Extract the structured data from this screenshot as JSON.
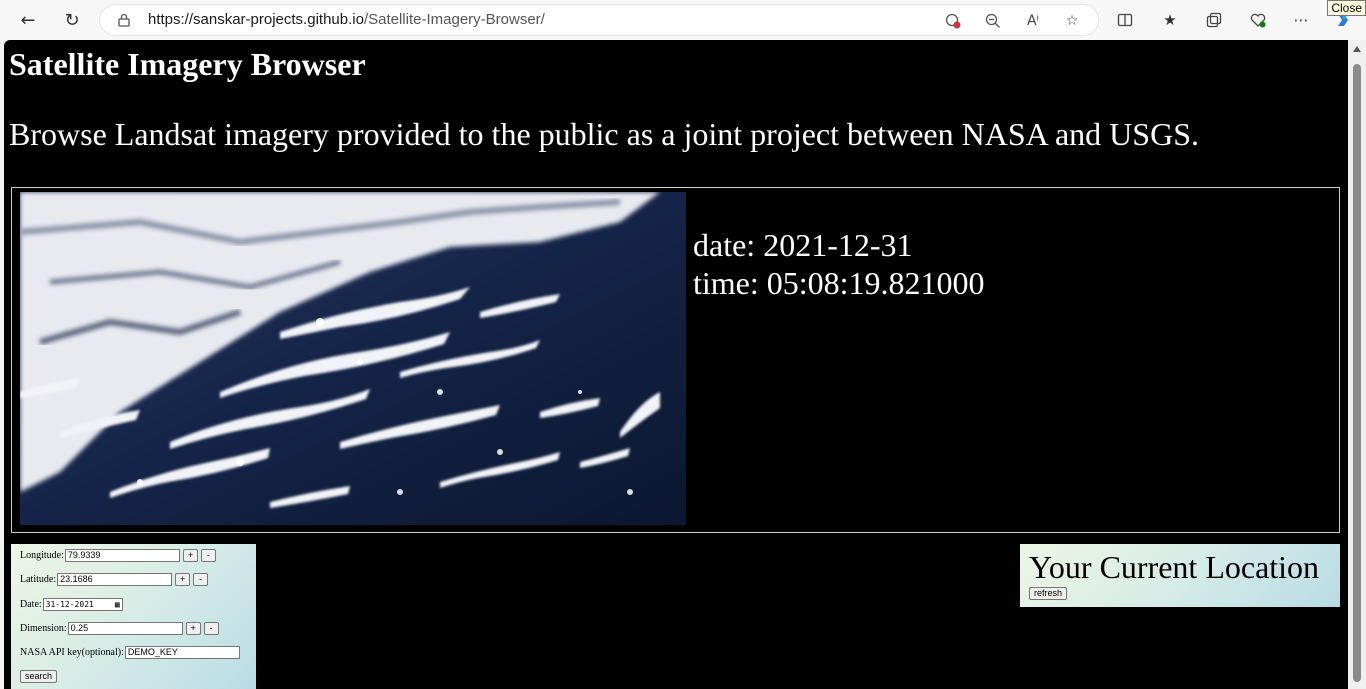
{
  "browser": {
    "url_host": "https://sanskar-projects.github.io",
    "url_path": "/Satellite-Imagery-Browser/",
    "tooltip": "Close"
  },
  "page": {
    "title": "Satellite Imagery Browser",
    "subtitle": "Browse Landsat imagery provided to the public as a joint project between NASA and USGS."
  },
  "image_info": {
    "date_line": "date: 2021-12-31",
    "time_line": "time: 05:08:19.821000"
  },
  "form": {
    "longitude_label": "Longitude:",
    "longitude_value": "79.9339",
    "latitude_label": "Latitude:",
    "latitude_value": "23.1686",
    "date_label": "Date:",
    "date_value": "31-12-2021",
    "dimension_label": "Dimension:",
    "dimension_value": "0.25",
    "api_key_label": "NASA API key(optional):",
    "api_key_value": "DEMO_KEY",
    "plus": "+",
    "minus": "-",
    "search_label": "search"
  },
  "location": {
    "title": "Your Current Location",
    "refresh_label": "refresh"
  }
}
